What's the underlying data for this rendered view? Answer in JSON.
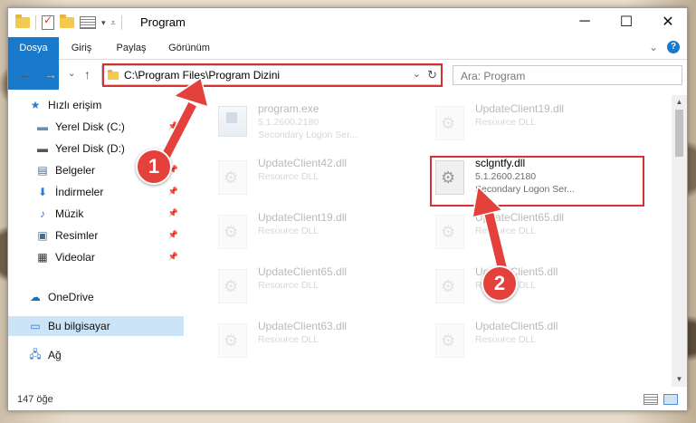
{
  "window": {
    "title": "Program",
    "minimize": "─",
    "maximize": "☐",
    "close": "✕"
  },
  "ribbon": {
    "tabs": [
      "Dosya",
      "Giriş",
      "Paylaş",
      "Görünüm"
    ],
    "expand": "⌄",
    "help": "?"
  },
  "address": {
    "path": "C:\\Program Files\\Program Dizini",
    "back": "←",
    "forward": "→",
    "recent": "⌄",
    "up": "↑",
    "dropdown": "⌄",
    "refresh": "↻"
  },
  "search": {
    "placeholder": "Ara: Program"
  },
  "nav": {
    "items": [
      {
        "label": "Hızlı erişim"
      },
      {
        "label": "Yerel Disk (C:)"
      },
      {
        "label": "Yerel Disk (D:)"
      },
      {
        "label": "Belgeler"
      },
      {
        "label": "İndirmeler"
      },
      {
        "label": "Müzik"
      },
      {
        "label": "Resimler"
      },
      {
        "label": "Videolar"
      },
      {
        "label": "OneDrive"
      },
      {
        "label": "Bu bilgisayar"
      },
      {
        "label": "Ağ"
      }
    ]
  },
  "files": [
    {
      "name": "program.exe",
      "line1": "5.1.2600.2180",
      "line2": "Secondary Logon Ser..."
    },
    {
      "name": "UpdateClient19.dll",
      "line1": "Resource DLL",
      "line2": ""
    },
    {
      "name": "UpdateClient42.dll",
      "line1": "Resource DLL",
      "line2": ""
    },
    {
      "name": "sclgntfy.dll",
      "line1": "5.1.2600.2180",
      "line2": "Secondary Logon Ser..."
    },
    {
      "name": "UpdateClient19.dll",
      "line1": "Resource DLL",
      "line2": ""
    },
    {
      "name": "UpdateClient65.dll",
      "line1": "Resource DLL",
      "line2": ""
    },
    {
      "name": "UpdateClient65.dll",
      "line1": "Resource DLL",
      "line2": ""
    },
    {
      "name": "UpdateClient5.dll",
      "line1": "Resource DLL",
      "line2": ""
    },
    {
      "name": "UpdateClient63.dll",
      "line1": "Resource DLL",
      "line2": ""
    },
    {
      "name": "UpdateClient5.dll",
      "line1": "Resource DLL",
      "line2": ""
    }
  ],
  "status": {
    "count": "147 öğe"
  },
  "annotations": {
    "badge1": "1",
    "badge2": "2",
    "color": "#e4403c"
  }
}
